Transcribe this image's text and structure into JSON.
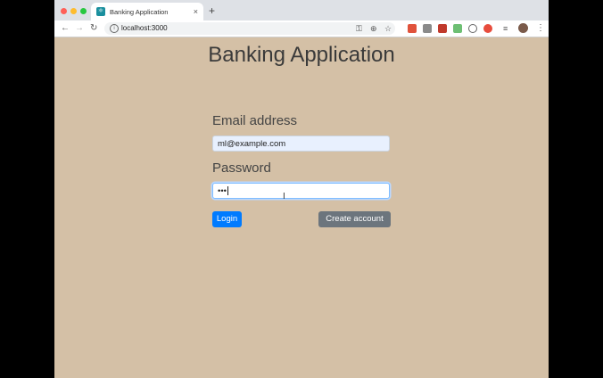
{
  "browser": {
    "tab_title": "Banking Application",
    "tab_close": "×",
    "new_tab": "+",
    "back": "←",
    "forward": "→",
    "reload": "↻",
    "url": "localhost:3000",
    "info_icon": "i",
    "key_icon": "⚿",
    "zoom_icon": "⊕",
    "star_icon": "☆",
    "menu_icon": "⋮"
  },
  "page": {
    "title": "Banking Application",
    "email_label": "Email address",
    "email_value": "ml@example.com",
    "password_label": "Password",
    "password_value": "•••",
    "login_label": "Login",
    "create_label": "Create account"
  },
  "colors": {
    "page_bg": "#d4c0a6",
    "primary": "#007bff",
    "secondary": "#6c757d",
    "autofill": "#e8f0fe"
  }
}
